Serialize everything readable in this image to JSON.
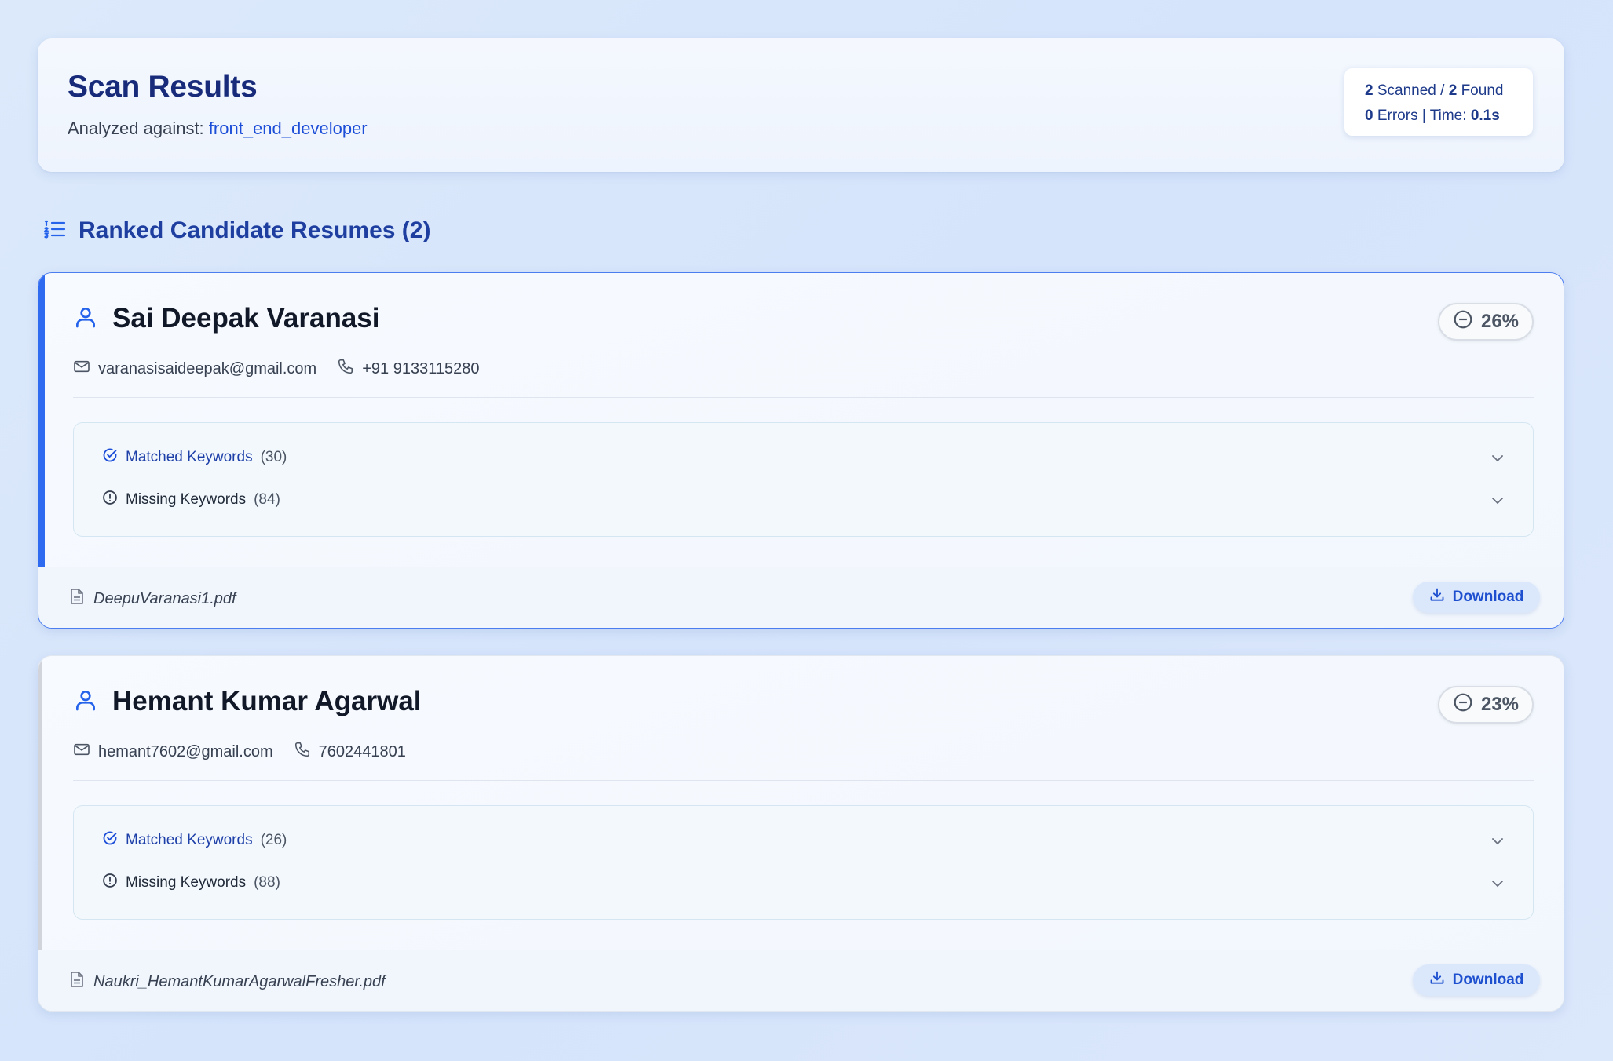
{
  "header": {
    "title": "Scan Results",
    "analyzed_prefix": "Analyzed against:",
    "role": "front_end_developer",
    "stats": {
      "scanned": "2",
      "scanned_label": "Scanned /",
      "found": "2",
      "found_label": "Found",
      "errors": "0",
      "errors_label": "Errors | Time:",
      "time": "0.1s"
    }
  },
  "section": {
    "title": "Ranked Candidate Resumes (2)",
    "icon": "list-ordered-icon"
  },
  "candidates": [
    {
      "name": "Sai Deepak Varanasi",
      "score": "26%",
      "email": "varanasisaideepak@gmail.com",
      "phone": "+91 9133115280",
      "matched_label": "Matched Keywords",
      "matched_count": "(30)",
      "missing_label": "Missing Keywords",
      "missing_count": "(84)",
      "file": "DeepuVaranasi1.pdf",
      "download_label": "Download"
    },
    {
      "name": "Hemant Kumar Agarwal",
      "score": "23%",
      "email": "hemant7602@gmail.com",
      "phone": "7602441801",
      "matched_label": "Matched Keywords",
      "matched_count": "(26)",
      "missing_label": "Missing Keywords",
      "missing_count": "(88)",
      "file": "Naukri_HemantKumarAgarwalFresher.pdf",
      "download_label": "Download"
    }
  ],
  "colors": {
    "accent": "#2f6bf0",
    "title": "#172b7a",
    "link": "#1d4ed8"
  }
}
